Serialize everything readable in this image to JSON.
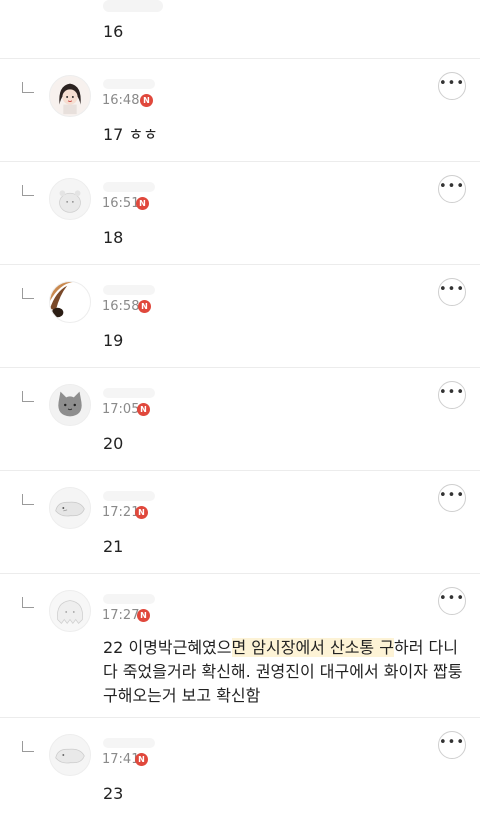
{
  "top_item": {
    "content": "16"
  },
  "replies": [
    {
      "time": "16:48",
      "badge": "N",
      "content": "17 ㅎㅎ"
    },
    {
      "time": "16:51",
      "badge": "N",
      "content": "18"
    },
    {
      "time": "16:58",
      "badge": "N",
      "content": "19"
    },
    {
      "time": "17:05",
      "badge": "N",
      "content": "20"
    },
    {
      "time": "17:21",
      "badge": "N",
      "content": "21"
    },
    {
      "time": "17:27",
      "badge": "N",
      "content_before": "22 이명박근혜였으",
      "content_highlight": "면 암시장에서 산소통 구",
      "content_after": "하러 다니다 죽었을거라 확신해. 권영진이 대구에서 화이자 짭퉁 구해오는거 보고 확신함"
    },
    {
      "time": "17:41",
      "badge": "N",
      "content": "23"
    }
  ],
  "more_label": "•••"
}
